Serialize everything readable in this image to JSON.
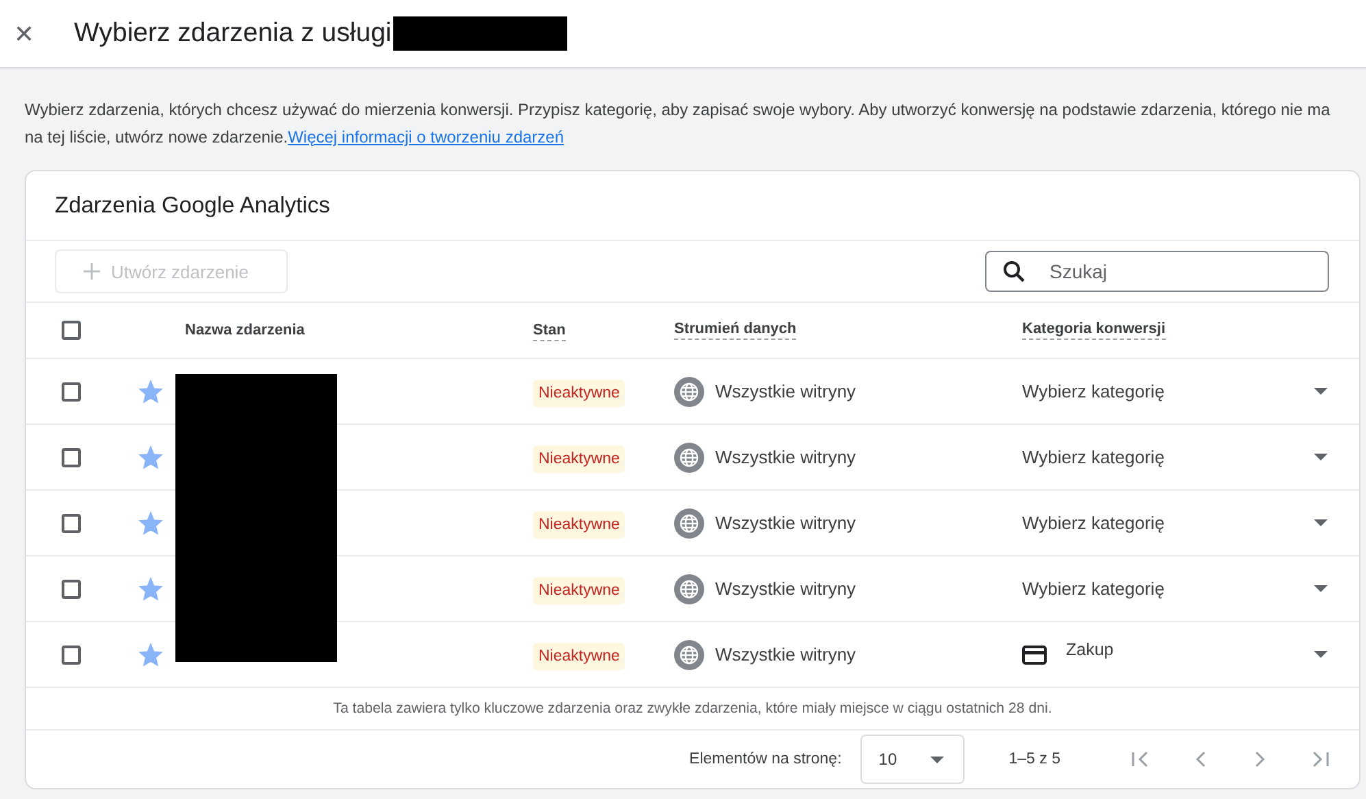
{
  "dialog": {
    "title": "Wybierz zdarzenia z usługi",
    "close_icon": "✕"
  },
  "intro": {
    "text": "Wybierz zdarzenia, których chcesz używać do mierzenia konwersji. Przypisz kategorię, aby zapisać swoje wybory. Aby utworzyć konwersję na podstawie zdarzenia, którego nie ma na tej liście, utwórz nowe zdarzenie.",
    "link": "Więcej informacji o tworzeniu zdarzeń"
  },
  "card": {
    "title": "Zdarzenia Google Analytics",
    "create_button": {
      "label": "Utwórz zdarzenie",
      "disabled": true
    },
    "search": {
      "placeholder": "Szukaj"
    },
    "table": {
      "select_all": {
        "checked": false
      },
      "columns": [
        "Nazwa zdarzenia",
        "Stan",
        "Strumień danych",
        "Kategoria konwersji"
      ],
      "rows": [
        {
          "checked": false,
          "starred": true,
          "status": "Nieaktywne",
          "stream": "Wszystkie witryny",
          "category": {
            "kind": "placeholder",
            "text": "Wybierz kategorię"
          }
        },
        {
          "checked": false,
          "starred": true,
          "status": "Nieaktywne",
          "stream": "Wszystkie witryny",
          "category": {
            "kind": "placeholder",
            "text": "Wybierz kategorię"
          }
        },
        {
          "checked": false,
          "starred": true,
          "status": "Nieaktywne",
          "stream": "Wszystkie witryny",
          "category": {
            "kind": "placeholder",
            "text": "Wybierz kategorię"
          }
        },
        {
          "checked": false,
          "starred": true,
          "status": "Nieaktywne",
          "stream": "Wszystkie witryny",
          "category": {
            "kind": "placeholder",
            "text": "Wybierz kategorię"
          }
        },
        {
          "checked": false,
          "starred": true,
          "status": "Nieaktywne",
          "stream": "Wszystkie witryny",
          "category": {
            "kind": "purchase",
            "text": "Zakup"
          }
        }
      ]
    },
    "note": "Ta tabela zawiera tylko kluczowe zdarzenia oraz zwykłe zdarzenia, które miały miejsce w ciągu ostatnich 28 dni.",
    "pagination": {
      "label": "Elementów na stronę:",
      "page_size": "10",
      "range": "1–5 z 5"
    }
  }
}
